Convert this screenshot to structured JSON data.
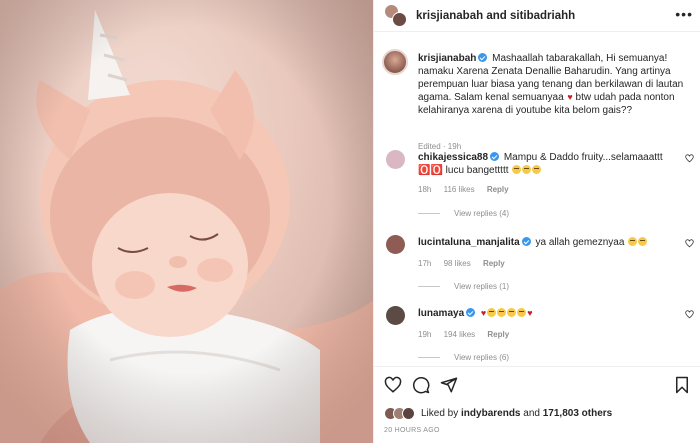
{
  "post": {
    "photo_alt": "",
    "header": {
      "title_user1": "krisjianabah",
      "title_and": "and",
      "title_user2": "sitibadriahh",
      "more_icon": "more-horizontal-icon"
    },
    "caption": {
      "username": "krisjianabah",
      "text_part1": "Mashaallah tabarakallah, Hi semuanya! namaku Xarena Zenata Denallie Baharudin. Yang artinya perempuan luar biasa yang tenang dan berkilawan di lautan agama. Salam kenal semuanyaa",
      "text_part2": "btw udah pada nonton kelahiranya xarena di youtube kita belom gais??",
      "meta": "Edited · 19h"
    },
    "comments": [
      {
        "username": "chikajessica88",
        "text": "Mampu & Daddo fruity...selamaaattt 🅾️🅾️ lucu bangettttt",
        "time": "18h",
        "likes": "116 likes",
        "reply": "Reply",
        "view_replies": "View replies (4)"
      },
      {
        "username": "lucintaluna_manjalita",
        "text": "ya allah gemeznyaa",
        "time": "17h",
        "likes": "98 likes",
        "reply": "Reply",
        "view_replies": "View replies (1)"
      },
      {
        "username": "lunamaya",
        "text": "",
        "time": "19h",
        "likes": "194 likes",
        "reply": "Reply",
        "view_replies": "View replies (6)"
      }
    ],
    "likes": {
      "prefix": "Liked by",
      "user": "indybarends",
      "and": "and",
      "others": "171,803 others"
    },
    "timeago": "20 HOURS AGO",
    "colors": {
      "verified": "#3897f0",
      "secondary_text": "#8e8e8e",
      "heart_red": "#c4222f"
    }
  }
}
